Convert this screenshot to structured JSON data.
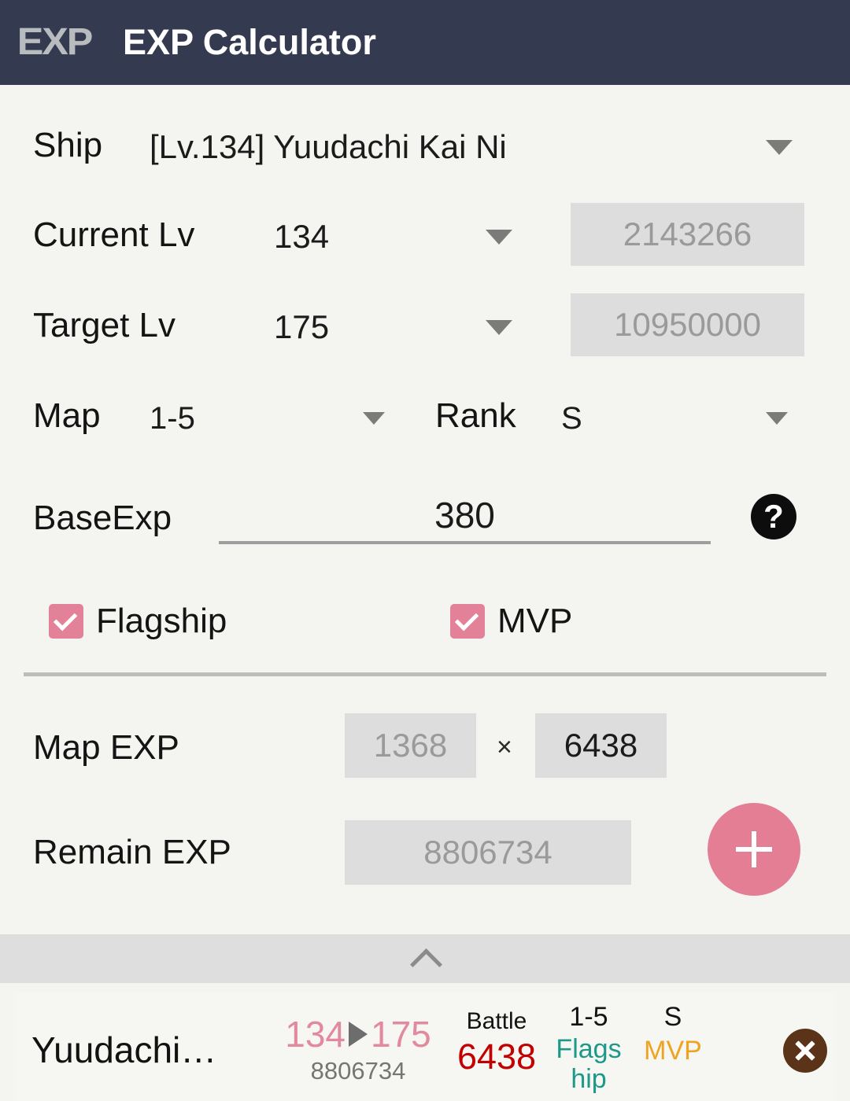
{
  "app": {
    "logo_text": "EXP",
    "title": "EXP Calculator",
    "appbar_color": "#343a4f",
    "accent_color": "#e3809a",
    "background_color": "#f4f4f1"
  },
  "form": {
    "ship": {
      "label": "Ship",
      "value": "[Lv.134] Yuudachi Kai Ni"
    },
    "current_lv": {
      "label": "Current Lv",
      "value": "134",
      "exp": "2143266"
    },
    "target_lv": {
      "label": "Target Lv",
      "value": "175",
      "exp": "10950000"
    },
    "map": {
      "label": "Map",
      "value": "1-5"
    },
    "rank": {
      "label": "Rank",
      "value": "S"
    },
    "base_exp": {
      "label": "BaseExp",
      "value": "380",
      "help": "?"
    },
    "flagship": {
      "label": "Flagship",
      "checked": true
    },
    "mvp": {
      "label": "MVP",
      "checked": true
    }
  },
  "results": {
    "map_exp": {
      "label": "Map EXP",
      "battles": "1368",
      "times": "×",
      "per_battle": "6438"
    },
    "remain_exp": {
      "label": "Remain EXP",
      "value": "8806734"
    },
    "add_button": "+"
  },
  "list": {
    "items": [
      {
        "ship_name": "Yuudachi…",
        "from_level": "134",
        "to_level": "175",
        "remain_exp": "8806734",
        "battle_label": "Battle",
        "battle_value": "6438",
        "map_label": "1-5",
        "map_value": "Flagship",
        "rank_label": "S",
        "rank_value": "MVP",
        "delete_label": "×"
      }
    ]
  }
}
